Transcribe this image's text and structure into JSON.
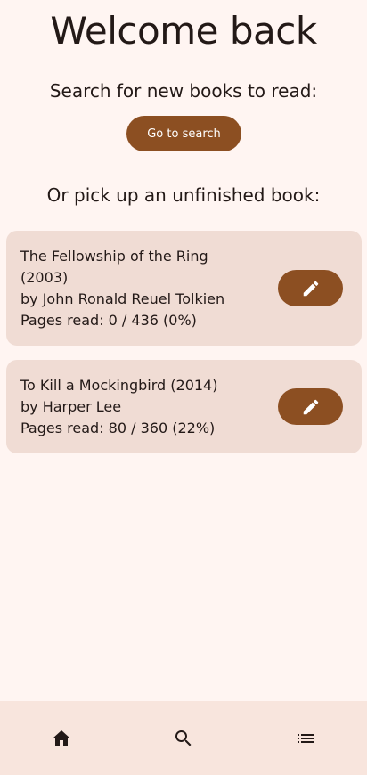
{
  "header": {
    "title": "Welcome back"
  },
  "search_section": {
    "prompt": "Search for new books to read:",
    "button_label": "Go to search"
  },
  "unfinished_section": {
    "prompt": "Or pick up an unfinished book:"
  },
  "books": [
    {
      "title_line": "The Fellowship of the Ring (2003)",
      "author_line": "by John Ronald Reuel Tolkien",
      "pages_line": "Pages read: 0 / 436 (0%)",
      "edit_icon": "pencil-icon"
    },
    {
      "title_line": "To Kill a Mockingbird (2014)",
      "author_line": "by Harper Lee",
      "pages_line": "Pages read: 80 / 360 (22%)",
      "edit_icon": "pencil-icon"
    }
  ],
  "bottom_nav": {
    "items": [
      {
        "icon": "home-icon"
      },
      {
        "icon": "search-icon"
      },
      {
        "icon": "list-icon"
      }
    ]
  },
  "colors": {
    "background": "#fff5f2",
    "accent": "#8c4f22",
    "card": "#f0dcd4",
    "nav_bar": "#f8e5dd",
    "text": "#231917"
  }
}
